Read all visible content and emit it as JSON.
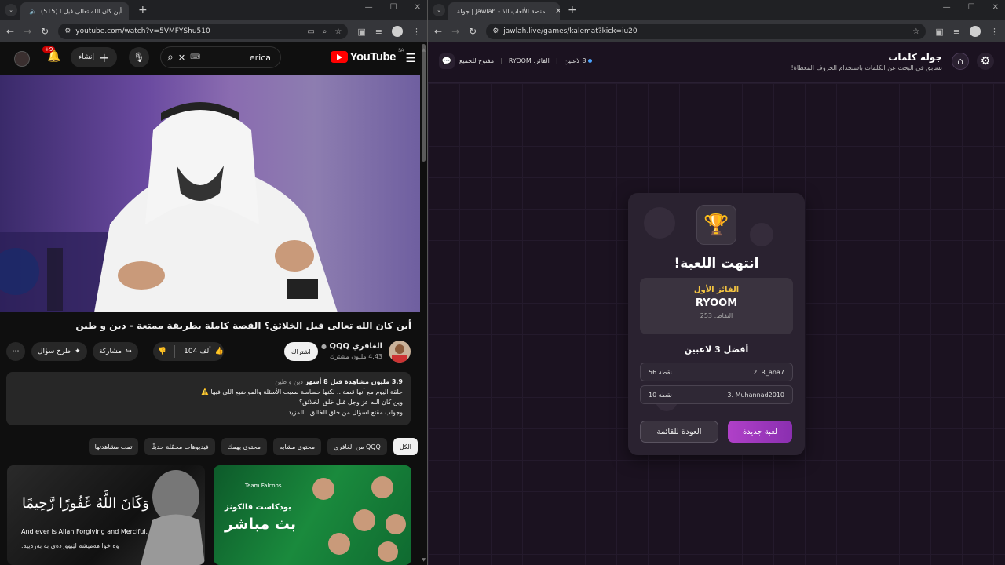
{
  "left_window": {
    "tab": {
      "title": "(515) أين كان الله تعالى قبل ا..."
    },
    "url": "youtube.com/watch?v=5VMFYShu510",
    "youtube": {
      "search_text": "erica",
      "create_label": "إنشاء",
      "notif_badge": "+9",
      "logo_text": "YouTube",
      "region": "SA",
      "video_title": "أين كان الله تعالى قبل الخلائق؟ القصة كاملة بطريقة ممتعة - دين و طين",
      "channel_name": "الغافري QQQ",
      "subscribers": "4.43 مليون مشترك",
      "subscribe_label": "اشتراك",
      "likes": "104 ألف",
      "share_label": "مشاركة",
      "ask_label": "طرح سؤال",
      "description": {
        "meta": "3.9 مليون مشاهدة  قبل 8 أشهر",
        "tags": "دين و طين",
        "line1": "حلقة اليوم مع أنها قصة .. لكنها حساسة بسبب الأسئلة والمواضيع اللي فيها ⚠️",
        "line2": "وين كان الله عز وجل قبل خلق الخلائق؟",
        "line3": "وجواب مقنع لسؤال من خلق الخالق...المزيد"
      },
      "chips": [
        "الكل",
        "من الغافري QQQ",
        "محتوى مشابه",
        "محتوى يهمك",
        "فيديوهات محمّلة حديثًا",
        "تمت مشاهدتها"
      ],
      "thumb1": {
        "arabic": "وَكَانَ اللَّهُ غَفُورًا رَّحِيمًا",
        "english": "And ever is Allah Forgiving and Merciful.",
        "sub": "وە خوا هەمیشە لێبووردەی بە بەزەییە."
      },
      "thumb2": {
        "line1": "بودكاست فالكونز",
        "line2": "بث مباشر",
        "brand": "Team Falcons"
      }
    }
  },
  "right_window": {
    "tab": {
      "title": "جولة | Jawlah - منصة الألعاب الذ..."
    },
    "url": "jawlah.live/games/kalemat?kick=iu20",
    "header": {
      "title": "جوله كلمات",
      "subtitle": "تسابق في البحث عن الكلمات باستخدام الحروف المعطاة!",
      "players": "8 لاعبين",
      "winner_meta": "الفائز: RYOOM",
      "open_label": "مفتوح للجميع"
    },
    "card": {
      "game_over": "انتهت اللعبة!",
      "first_label": "الفائز الأول",
      "winner_name": "RYOOM",
      "winner_points": "النقاط: 253",
      "top3_label": "أفضل 3 لاعبين",
      "players": [
        {
          "rank_name": "2. R_ana7",
          "points": "56 نقطة"
        },
        {
          "rank_name": "3. Muhannad2010",
          "points": "10 نقطة"
        }
      ],
      "new_game": "لعبة جديدة",
      "back": "العودة للقائمة"
    }
  }
}
